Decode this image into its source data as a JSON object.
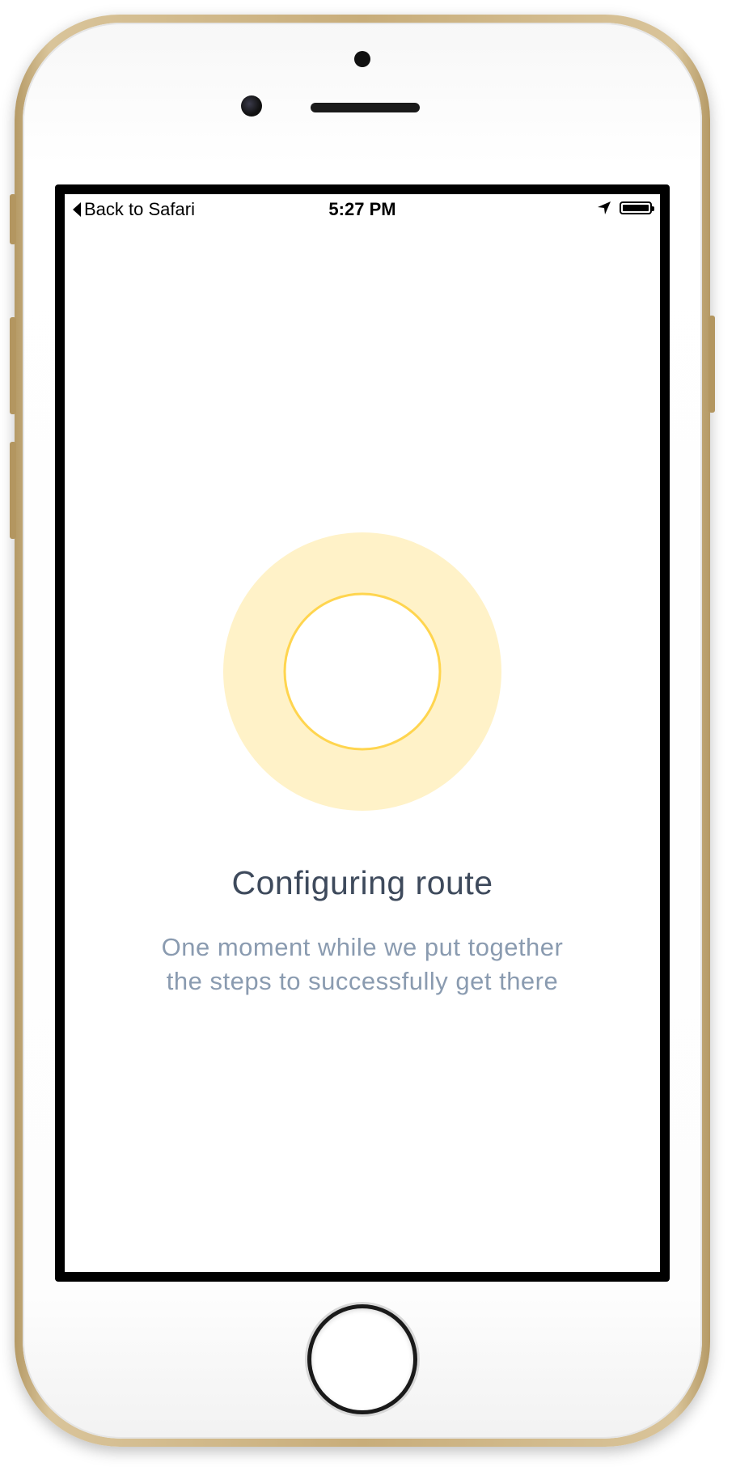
{
  "status_bar": {
    "back_label": "Back to Safari",
    "time": "5:27 PM",
    "location_icon": "location-arrow-icon",
    "battery_icon": "battery-full-icon"
  },
  "loading": {
    "title": "Configuring route",
    "message_line_1": "One moment while we put together",
    "message_line_2": "the steps to successfully get there"
  },
  "colors": {
    "ring_outer": "#fff2c8",
    "ring_inner_stroke": "#ffd54f",
    "title": "#3e4a5c",
    "message": "#8a9bb0",
    "device_frame": "#c8ad7a"
  }
}
